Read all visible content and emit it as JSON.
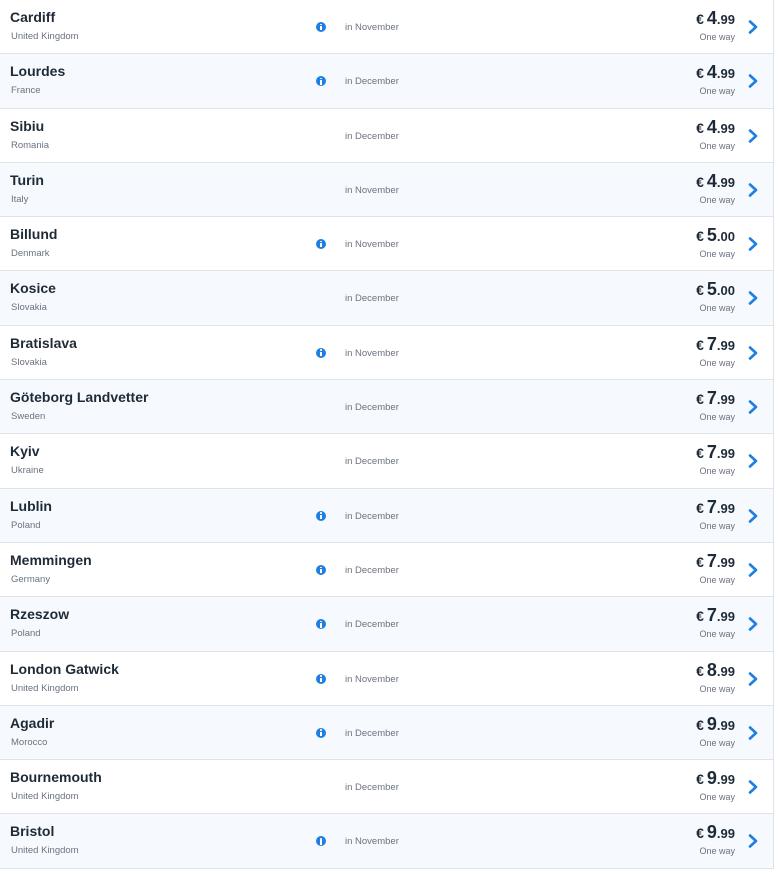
{
  "accent_color": "#1f7fe0",
  "flights": [
    {
      "city": "Cardiff",
      "country": "United Kingdom",
      "info": true,
      "month": "in November",
      "currency": "€",
      "whole": "4",
      "cents": ".99",
      "note": "One way"
    },
    {
      "city": "Lourdes",
      "country": "France",
      "info": true,
      "month": "in December",
      "currency": "€",
      "whole": "4",
      "cents": ".99",
      "note": "One way"
    },
    {
      "city": "Sibiu",
      "country": "Romania",
      "info": false,
      "month": "in December",
      "currency": "€",
      "whole": "4",
      "cents": ".99",
      "note": "One way"
    },
    {
      "city": "Turin",
      "country": "Italy",
      "info": false,
      "month": "in November",
      "currency": "€",
      "whole": "4",
      "cents": ".99",
      "note": "One way"
    },
    {
      "city": "Billund",
      "country": "Denmark",
      "info": true,
      "month": "in November",
      "currency": "€",
      "whole": "5",
      "cents": ".00",
      "note": "One way"
    },
    {
      "city": "Kosice",
      "country": "Slovakia",
      "info": false,
      "month": "in December",
      "currency": "€",
      "whole": "5",
      "cents": ".00",
      "note": "One way"
    },
    {
      "city": "Bratislava",
      "country": "Slovakia",
      "info": true,
      "month": "in November",
      "currency": "€",
      "whole": "7",
      "cents": ".99",
      "note": "One way"
    },
    {
      "city": "Göteborg Landvetter",
      "country": "Sweden",
      "info": false,
      "month": "in December",
      "currency": "€",
      "whole": "7",
      "cents": ".99",
      "note": "One way"
    },
    {
      "city": "Kyiv",
      "country": "Ukraine",
      "info": false,
      "month": "in December",
      "currency": "€",
      "whole": "7",
      "cents": ".99",
      "note": "One way"
    },
    {
      "city": "Lublin",
      "country": "Poland",
      "info": true,
      "month": "in December",
      "currency": "€",
      "whole": "7",
      "cents": ".99",
      "note": "One way"
    },
    {
      "city": "Memmingen",
      "country": "Germany",
      "info": true,
      "month": "in December",
      "currency": "€",
      "whole": "7",
      "cents": ".99",
      "note": "One way"
    },
    {
      "city": "Rzeszow",
      "country": "Poland",
      "info": true,
      "month": "in December",
      "currency": "€",
      "whole": "7",
      "cents": ".99",
      "note": "One way"
    },
    {
      "city": "London Gatwick",
      "country": "United Kingdom",
      "info": true,
      "month": "in November",
      "currency": "€",
      "whole": "8",
      "cents": ".99",
      "note": "One way"
    },
    {
      "city": "Agadir",
      "country": "Morocco",
      "info": true,
      "month": "in December",
      "currency": "€",
      "whole": "9",
      "cents": ".99",
      "note": "One way"
    },
    {
      "city": "Bournemouth",
      "country": "United Kingdom",
      "info": false,
      "month": "in December",
      "currency": "€",
      "whole": "9",
      "cents": ".99",
      "note": "One way"
    },
    {
      "city": "Bristol",
      "country": "United Kingdom",
      "info": true,
      "month": "in November",
      "currency": "€",
      "whole": "9",
      "cents": ".99",
      "note": "One way"
    }
  ]
}
